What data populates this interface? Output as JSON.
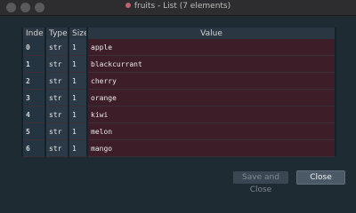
{
  "window": {
    "title": "fruits - List (7 elements)"
  },
  "table": {
    "headers": {
      "index": "Inde",
      "type": "Type",
      "size": "Size",
      "value": "Value"
    },
    "rows": [
      {
        "index": "0",
        "type": "str",
        "size": "1",
        "value": "apple"
      },
      {
        "index": "1",
        "type": "str",
        "size": "1",
        "value": "blackcurrant"
      },
      {
        "index": "2",
        "type": "str",
        "size": "1",
        "value": "cherry"
      },
      {
        "index": "3",
        "type": "str",
        "size": "1",
        "value": "orange"
      },
      {
        "index": "4",
        "type": "str",
        "size": "1",
        "value": "kiwi"
      },
      {
        "index": "5",
        "type": "str",
        "size": "1",
        "value": "melon"
      },
      {
        "index": "6",
        "type": "str",
        "size": "1",
        "value": "mango"
      }
    ]
  },
  "buttons": {
    "save_close": "Save and Close",
    "close": "Close"
  },
  "colors": {
    "background": "#1f2b33",
    "value_cell": "#3d1e28",
    "index_cell": "#243440"
  }
}
